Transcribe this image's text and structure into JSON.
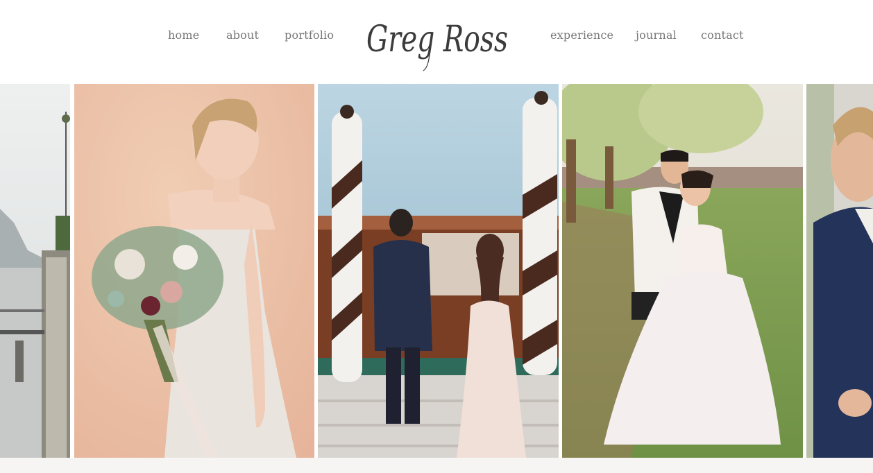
{
  "brand": {
    "logo_text": "Greg Ross"
  },
  "nav": {
    "left": [
      {
        "label": "home"
      },
      {
        "label": "about"
      },
      {
        "label": "portfolio"
      }
    ],
    "right": [
      {
        "label": "experience"
      },
      {
        "label": "journal"
      },
      {
        "label": "contact"
      }
    ]
  },
  "gallery": {
    "photos": [
      {
        "subject": "lakeside promenade with mountains"
      },
      {
        "subject": "bride holding bouquet against peach wall"
      },
      {
        "subject": "couple walking down steps to boat"
      },
      {
        "subject": "couple embracing in vineyard field"
      },
      {
        "subject": "groom in navy suit"
      }
    ]
  },
  "colors": {
    "nav_text": "#777777",
    "logo_ink": "#3b3b3b",
    "footer_bg": "#f7f5f3"
  }
}
